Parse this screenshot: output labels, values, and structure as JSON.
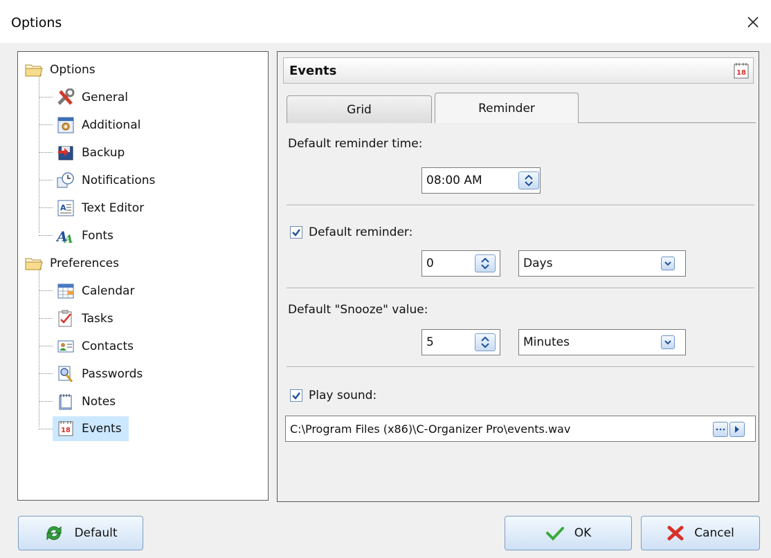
{
  "window": {
    "title": "Options"
  },
  "tree": {
    "groups": [
      {
        "label": "Options",
        "icon": "folder-icon",
        "children": [
          {
            "label": "General",
            "icon": "tools-icon"
          },
          {
            "label": "Additional",
            "icon": "settings-window-icon"
          },
          {
            "label": "Backup",
            "icon": "backup-icon"
          },
          {
            "label": "Notifications",
            "icon": "notification-clock-icon"
          },
          {
            "label": "Text Editor",
            "icon": "text-editor-icon"
          },
          {
            "label": "Fonts",
            "icon": "fonts-icon"
          }
        ]
      },
      {
        "label": "Preferences",
        "icon": "folder-icon",
        "children": [
          {
            "label": "Calendar",
            "icon": "calendar-icon"
          },
          {
            "label": "Tasks",
            "icon": "tasks-icon"
          },
          {
            "label": "Contacts",
            "icon": "contacts-icon"
          },
          {
            "label": "Passwords",
            "icon": "passwords-icon"
          },
          {
            "label": "Notes",
            "icon": "notes-icon"
          },
          {
            "label": "Events",
            "icon": "events-icon",
            "selected": true
          }
        ]
      }
    ]
  },
  "panel": {
    "title": "Events",
    "tabs": [
      {
        "label": "Grid"
      },
      {
        "label": "Reminder",
        "active": true
      }
    ],
    "reminder_time": {
      "label": "Default reminder time:",
      "value": "08:00 AM"
    },
    "default_reminder": {
      "label": "Default reminder:",
      "checked": true,
      "value": "0",
      "unit": "Days"
    },
    "snooze": {
      "label": "Default \"Snooze\" value:",
      "value": "5",
      "unit": "Minutes"
    },
    "play_sound": {
      "label": "Play sound:",
      "checked": true,
      "path": "C:\\Program Files (x86)\\C-Organizer Pro\\events.wav"
    }
  },
  "buttons": {
    "default": "Default",
    "ok": "OK",
    "cancel": "Cancel"
  },
  "colors": {
    "selection": "#cce8ff",
    "button_border": "#7d9cc4",
    "panel_border": "#5a5a5a"
  }
}
